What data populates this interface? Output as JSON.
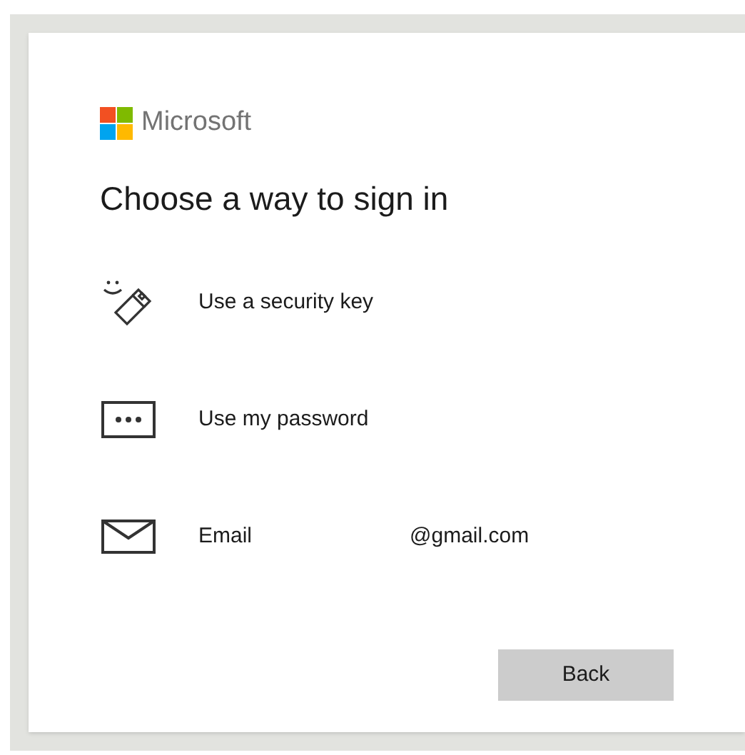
{
  "brand": {
    "name": "Microsoft"
  },
  "heading": "Choose a way to sign in",
  "options": [
    {
      "kind": "security_key",
      "label": "Use a security key"
    },
    {
      "kind": "password",
      "label": "Use my password"
    },
    {
      "kind": "email",
      "label": "Email",
      "detail": "@gmail.com"
    }
  ],
  "buttons": [
    "Back"
  ]
}
